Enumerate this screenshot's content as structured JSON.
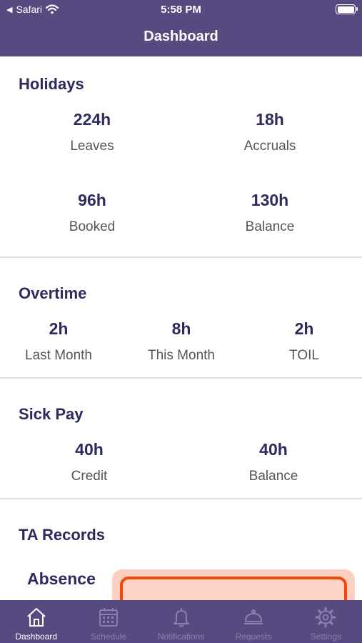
{
  "status_bar": {
    "back_app": "Safari",
    "time": "5:58 PM"
  },
  "nav": {
    "title": "Dashboard"
  },
  "holidays": {
    "title": "Holidays",
    "stats": [
      {
        "value": "224h",
        "label": "Leaves"
      },
      {
        "value": "18h",
        "label": "Accruals"
      },
      {
        "value": "96h",
        "label": "Booked"
      },
      {
        "value": "130h",
        "label": "Balance"
      }
    ]
  },
  "overtime": {
    "title": "Overtime",
    "stats": [
      {
        "value": "2h",
        "label": "Last Month"
      },
      {
        "value": "8h",
        "label": "This Month"
      },
      {
        "value": "2h",
        "label": "TOIL"
      }
    ]
  },
  "sick_pay": {
    "title": "Sick Pay",
    "stats": [
      {
        "value": "40h",
        "label": "Credit"
      },
      {
        "value": "40h",
        "label": "Balance"
      }
    ]
  },
  "ta_records": {
    "title": "TA Records",
    "absence_label": "Absence"
  },
  "tabs": [
    {
      "label": "Dashboard",
      "icon": "home-icon",
      "active": true
    },
    {
      "label": "Schedule",
      "icon": "calendar-icon",
      "active": false
    },
    {
      "label": "Notifications",
      "icon": "bell-icon",
      "active": false
    },
    {
      "label": "Requests",
      "icon": "service-bell-icon",
      "active": false
    },
    {
      "label": "Settings",
      "icon": "gear-icon",
      "active": false
    }
  ],
  "colors": {
    "header_bg": "#574a80",
    "heading_text": "#2d2a5e",
    "absence_border": "#f04a0a",
    "absence_fill": "#fccfc0"
  }
}
